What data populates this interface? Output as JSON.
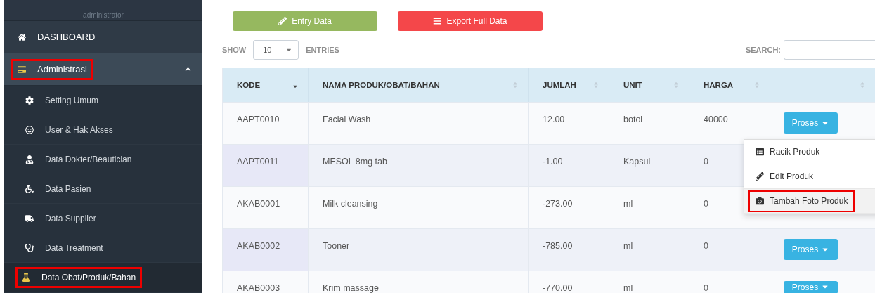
{
  "sidebar": {
    "user_role": "administrator",
    "items": [
      {
        "label": "DASHBOARD",
        "kind": "top",
        "annotated": false
      },
      {
        "label": "Administrasi",
        "kind": "group",
        "expanded": true,
        "annotated": true,
        "children": [
          {
            "label": "Setting Umum",
            "selected": false,
            "annotated": false
          },
          {
            "label": "User & Hak Akses",
            "selected": false,
            "annotated": false
          },
          {
            "label": "Data Dokter/Beautician",
            "selected": false,
            "annotated": false
          },
          {
            "label": "Data Pasien",
            "selected": false,
            "annotated": false
          },
          {
            "label": "Data Supplier",
            "selected": false,
            "annotated": false
          },
          {
            "label": "Data Treatment",
            "selected": false,
            "annotated": false
          },
          {
            "label": "Data Obat/Produk/Bahan",
            "selected": true,
            "annotated": true
          }
        ]
      }
    ]
  },
  "toolbar": {
    "buttons": [
      {
        "label": "Entry Data",
        "kind": "entry"
      },
      {
        "label": "Export Full Data",
        "kind": "export"
      }
    ]
  },
  "table_controls": {
    "show_label": "SHOW",
    "page_size": "10",
    "entries_label": "ENTRIES",
    "search_label": "SEARCH:"
  },
  "table": {
    "columns": [
      {
        "label": "KODE",
        "sorted": true
      },
      {
        "label": "NAMA PRODUK/OBAT/BAHAN",
        "sorted": false
      },
      {
        "label": "JUMLAH",
        "sorted": false
      },
      {
        "label": "UNIT",
        "sorted": false
      },
      {
        "label": "HARGA",
        "sorted": false
      },
      {
        "sorted": false
      }
    ],
    "rows": [
      {
        "cells": [
          "AAPT0010",
          "Facial Wash",
          "12.00",
          "botol",
          "40000"
        ],
        "action": "Proses"
      },
      {
        "cells": [
          "AAPT0011",
          "MESOL 8mg tab",
          "-1.00",
          "Kapsul",
          "0"
        ]
      },
      {
        "cells": [
          "AKAB0001",
          "Milk cleansing",
          "-273.00",
          "ml",
          "0"
        ]
      },
      {
        "cells": [
          "AKAB0002",
          "Tooner",
          "-785.00",
          "ml",
          "0"
        ],
        "action": "Proses"
      },
      {
        "cells": [
          "AKAB0003",
          "Krim massage",
          "-770.00",
          "ml",
          "0"
        ],
        "action": "Proses"
      }
    ]
  },
  "action_menu": {
    "items": [
      {
        "label": "Racik Produk",
        "selected": false,
        "annotated": false
      },
      {
        "label": "Edit Produk",
        "selected": false,
        "annotated": false
      },
      {
        "label": "Tambah Foto Produk",
        "selected": true,
        "annotated": true
      }
    ]
  }
}
